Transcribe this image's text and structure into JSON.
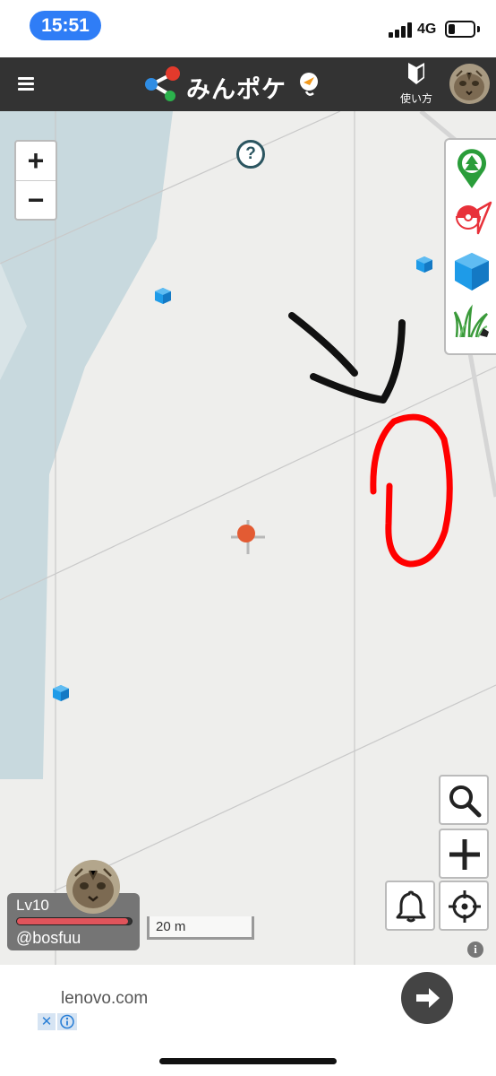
{
  "status_bar": {
    "time": "15:51",
    "network": "4G"
  },
  "header": {
    "logo_text": "みんポケ",
    "howto_label": "使い方",
    "colors": {
      "background": "#333333",
      "logo_red": "#e33a2c",
      "logo_blue": "#2f8de4",
      "logo_green": "#2bb24c"
    }
  },
  "map": {
    "zoom_in_label": "+",
    "zoom_out_label": "−",
    "help_marker_label": "?",
    "layers": [
      "pokestop-filter-icon",
      "pokemon-filter-icon",
      "cube-filter-icon",
      "grass-filter-icon"
    ],
    "colors": {
      "land": "#eeeeec",
      "water": "#c8d9de",
      "cube": "#1e9be8",
      "player_dot": "#e35b33",
      "annotation_red": "#ff0000"
    }
  },
  "player": {
    "level": "Lv10",
    "handle": "@bosfuu",
    "hp_fraction": 0.97
  },
  "scale_bar": {
    "label": "20 m"
  },
  "ad": {
    "domain": "lenovo.com",
    "close_label": "✕"
  }
}
